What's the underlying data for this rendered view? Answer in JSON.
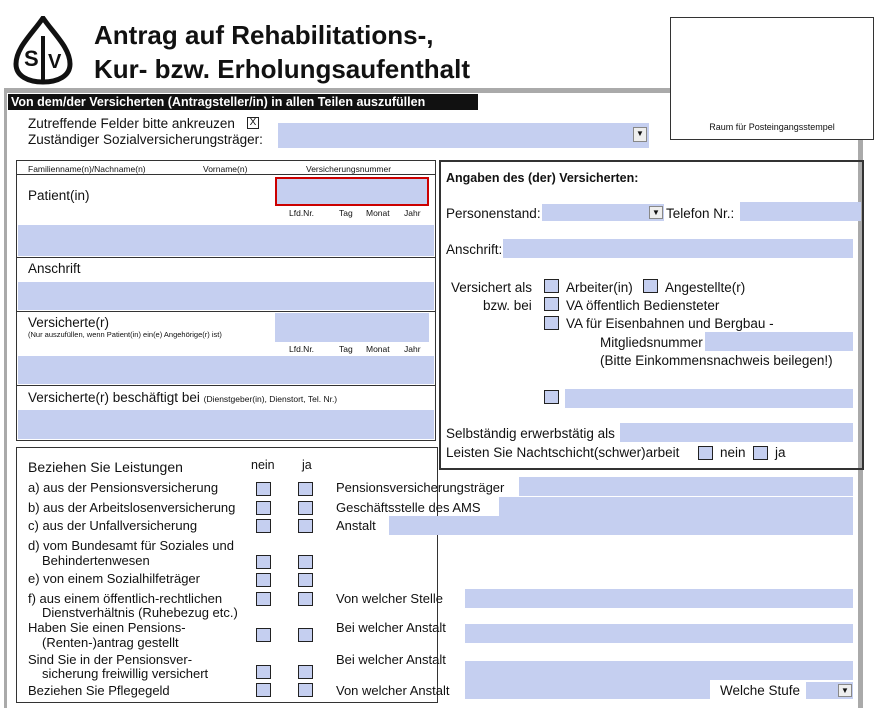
{
  "header": {
    "title_line1": "Antrag auf Rehabilitations-,",
    "title_line2": "Kur- bzw. Erholungsaufenthalt",
    "stamp_label": "Raum für Posteingangsstempel",
    "banner": "Von dem/der Versicherten (Antragsteller/in) in allen Teilen auszufüllen",
    "check_hint": "Zutreffende Felder bitte ankreuzen",
    "check_hint_mark": "X",
    "insurer_label": "Zuständiger Sozialversicherungsträger:"
  },
  "patient_box": {
    "col_name": "Familienname(n)/Nachname(n)",
    "col_vorname": "Vorname(n)",
    "col_svn": "Versicherungsnummer",
    "patient_label": "Patient(in)",
    "lfd": "Lfd.Nr.",
    "tag": "Tag",
    "monat": "Monat",
    "jahr": "Jahr",
    "anschrift": "Anschrift",
    "versicherte": "Versicherte(r)",
    "versicherte_note": "(Nur auszufüllen, wenn Patient(in) ein(e) Angehörige(r) ist)",
    "employed_label": "Versicherte(r) beschäftigt bei",
    "employed_note": "(Dienstgeber(in), Dienstort, Tel. Nr.)"
  },
  "right_box": {
    "title": "Angaben des (der) Versicherten:",
    "personenstand": "Personenstand:",
    "telefon": "Telefon Nr.:",
    "anschrift": "Anschrift:",
    "versichert_als": "Versichert als",
    "bzw_bei": "bzw. bei",
    "arbeiter": "Arbeiter(in)",
    "angestellte": "Angestellte(r)",
    "va_oeff": "VA öffentlich Bediensteter",
    "va_eisen": "VA für Eisenbahnen und Bergbau -",
    "mitglied": "Mitgliedsnummer",
    "einkommen": "(Bitte Einkommensnachweis beilegen!)",
    "selbst": "Selbständig erwerbstätig als",
    "nacht": "Leisten Sie Nachtschicht(schwer)arbeit",
    "nein": "nein",
    "ja": "ja"
  },
  "benefits": {
    "heading": "Beziehen Sie Leistungen",
    "nein": "nein",
    "ja": "ja",
    "rows": [
      {
        "l1": "a) aus der Pensionsversicherung",
        "l2": "",
        "right": "Pensionsversicherungsträger"
      },
      {
        "l1": "b) aus der Arbeitslosenversicherung",
        "l2": "",
        "right": "Geschäftsstelle des AMS"
      },
      {
        "l1": "c) aus der Unfallversicherung",
        "l2": "",
        "right": "Anstalt"
      },
      {
        "l1": "d) vom Bundesamt für Soziales und",
        "l2": "Behindertenwesen",
        "right": ""
      },
      {
        "l1": "e) von einem Sozialhilfeträger",
        "l2": "",
        "right": ""
      },
      {
        "l1": "f)  aus einem öffentlich-rechtlichen",
        "l2": "Dienstverhältnis (Ruhebezug etc.)",
        "right": "Von welcher Stelle"
      },
      {
        "l1": "Haben Sie einen Pensions-",
        "l2": "(Renten-)antrag gestellt",
        "right": "Bei welcher Anstalt"
      },
      {
        "l1": "Sind Sie in der Pensionsver-",
        "l2": "sicherung freiwillig versichert",
        "right": "Bei welcher Anstalt"
      },
      {
        "l1": "Beziehen Sie Pflegegeld",
        "l2": "",
        "right": "Von welcher Anstalt"
      }
    ],
    "stufe": "Welche Stufe"
  }
}
